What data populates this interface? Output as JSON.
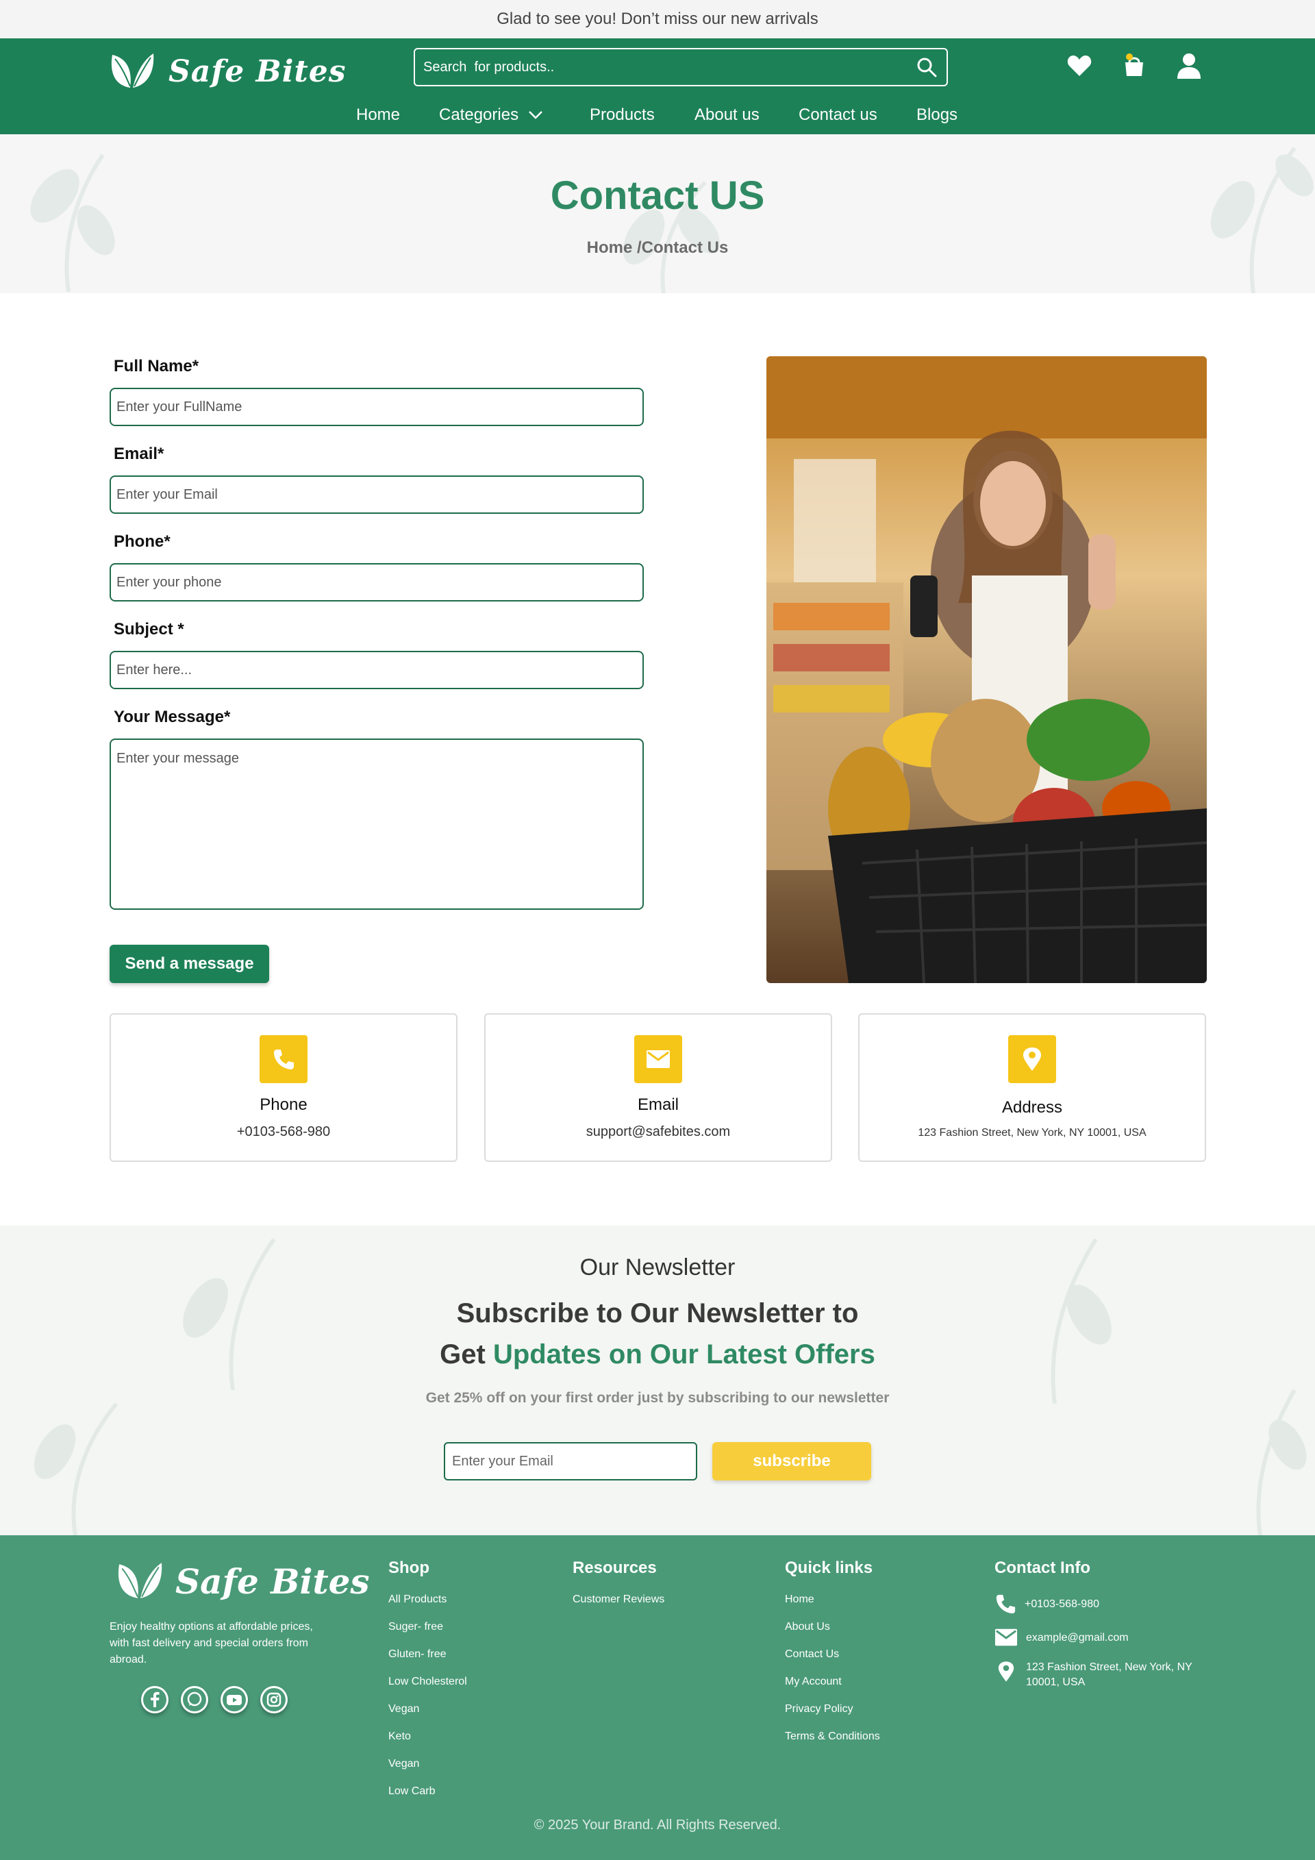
{
  "announcement": "Glad to see you! Don’t miss our new arrivals",
  "brand": {
    "name": "Safe Bites",
    "primary_color": "#1d8158",
    "accent_color": "#f5c518"
  },
  "header": {
    "search_placeholder": "Search  for products..",
    "icons": [
      "search-icon",
      "heart-icon",
      "cart-icon",
      "user-icon"
    ]
  },
  "nav": {
    "home": "Home",
    "categories": "Categories",
    "products": "Products",
    "about": "About us",
    "contact": "Contact us",
    "blogs": "Blogs"
  },
  "hero": {
    "title": "Contact US",
    "breadcrumb": "Home /Contact Us"
  },
  "form": {
    "full_name_label": "Full Name*",
    "full_name_placeholder": "Enter your FullName",
    "email_label": "Email*",
    "email_placeholder": "Enter your Email",
    "phone_label": "Phone*",
    "phone_placeholder": "Enter your phone",
    "subject_label": "Subject *",
    "subject_placeholder": "Enter here...",
    "message_label": "Your Message*",
    "message_placeholder": "Enter your message",
    "submit_label": "Send a message"
  },
  "info_cards": {
    "phone": {
      "title": "Phone",
      "value": "+0103-568-980",
      "icon": "phone-icon"
    },
    "email": {
      "title": "Email",
      "value": "support@safebites.com",
      "icon": "mail-icon"
    },
    "address": {
      "title": "Address",
      "value": "123 Fashion Street, New York, NY 10001, USA",
      "icon": "map-pin-icon"
    }
  },
  "newsletter": {
    "subtitle": "Our Newsletter",
    "heading_line1": "Subscribe to Our Newsletter to",
    "heading_line2_plain": "Get ",
    "heading_line2_accent": "Updates on Our Latest Offers",
    "description": "Get 25% off on your first order just by subscribing to our newsletter",
    "email_placeholder": "Enter your Email",
    "button_label": "subscribe"
  },
  "footer": {
    "description": "Enjoy healthy options at affordable prices, with fast delivery and special orders from abroad.",
    "socials": [
      "facebook-icon",
      "whatsapp-icon",
      "youtube-icon",
      "instagram-icon"
    ],
    "shop": {
      "title": "Shop",
      "items": [
        "All  Products",
        "Suger- free",
        "Gluten- free",
        "Low Cholesterol",
        "Vegan",
        "Keto",
        "Vegan",
        "Low Carb"
      ]
    },
    "resources": {
      "title": "Resources",
      "items": [
        "Customer Reviews"
      ]
    },
    "quick_links": {
      "title": "Quick links",
      "items": [
        "Home",
        "About Us",
        "Contact Us",
        "My Account",
        "Privacy Policy",
        "Terms & Conditions"
      ]
    },
    "contact_info": {
      "title": "Contact Info",
      "phone": "+0103-568-980",
      "email": "example@gmail.com",
      "address": "123 Fashion Street, New York, NY 10001, USA"
    },
    "copyright": "© 2025 Your Brand. All Rights Reserved."
  }
}
